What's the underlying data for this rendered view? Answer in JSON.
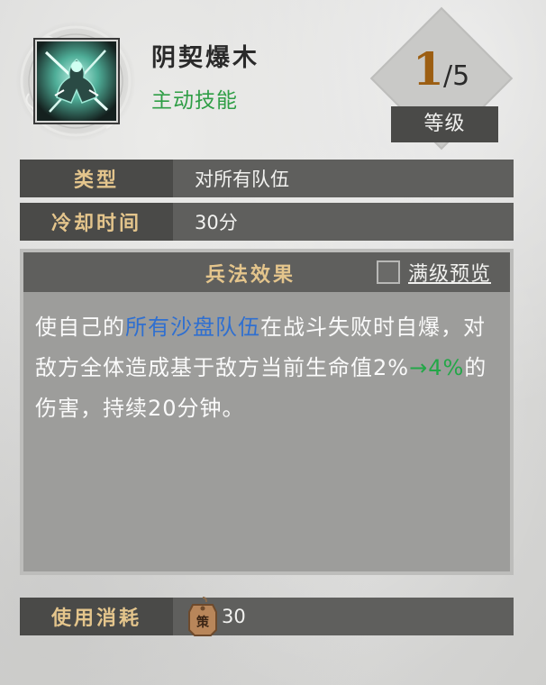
{
  "skill": {
    "name": "阴契爆木",
    "kind": "主动技能",
    "icon": "necromancer-skill-icon"
  },
  "level": {
    "current": "1",
    "max": "5",
    "separator": "/",
    "label": "等级"
  },
  "rows": {
    "type": {
      "label": "类型",
      "value": "对所有队伍"
    },
    "cooldown": {
      "label": "冷却时间",
      "value": "30分"
    }
  },
  "effect": {
    "title": "兵法效果",
    "max_level_preview": "满级预览",
    "text_1": "使自己的",
    "text_highlight": "所有沙盘队伍",
    "text_2": "在战斗失败时自爆，对敌方全体造成基于敌方当前生命值2%",
    "text_upgrade": "→4%",
    "text_3": "的伤害，持续20分钟。"
  },
  "cost": {
    "label": "使用消耗",
    "value": "30",
    "icon": "strategy-token-icon",
    "token_char": "策"
  },
  "colors": {
    "label_gold": "#e4c58c",
    "active_green": "#2f9e46",
    "highlight_blue": "#2f6fd0",
    "upgrade_green": "#23a748",
    "level_brown": "#9c5e12"
  }
}
